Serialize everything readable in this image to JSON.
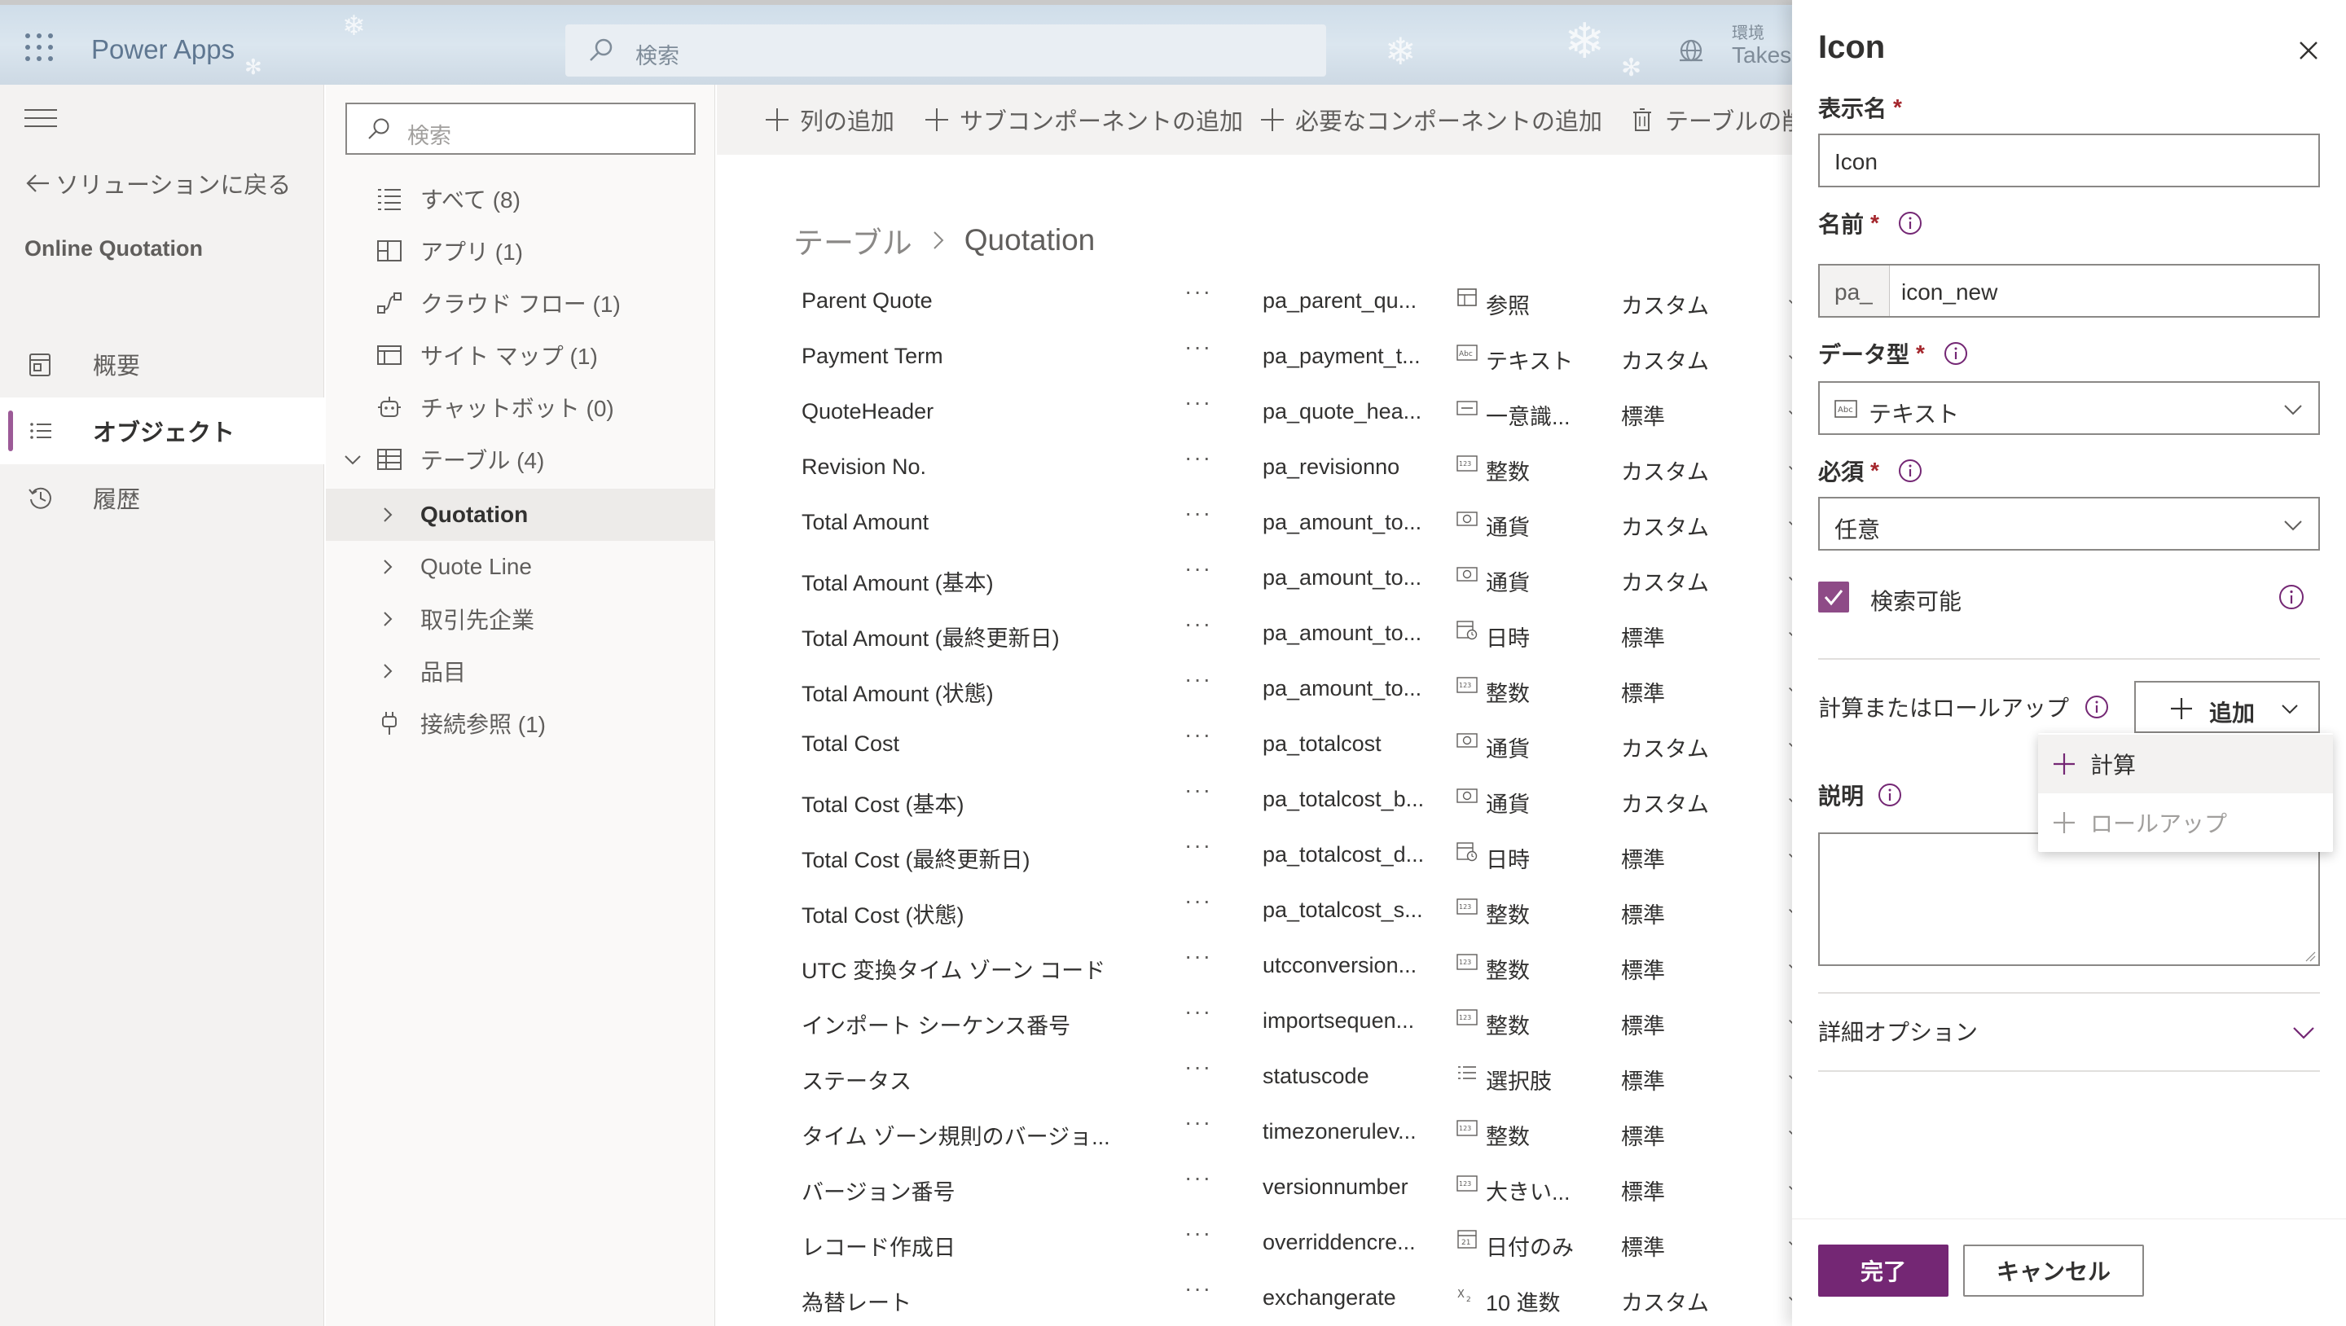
{
  "header": {
    "brand": "Power Apps",
    "search_placeholder": "検索",
    "env_label": "環境",
    "env_user": "Takeshi"
  },
  "leftnav": {
    "back_label": "ソリューションに戻る",
    "solution_name": "Online Quotation",
    "items": [
      {
        "label": "概要",
        "icon": "overview-icon"
      },
      {
        "label": "オブジェクト",
        "icon": "objects-icon",
        "active": true
      },
      {
        "label": "履歴",
        "icon": "history-icon"
      }
    ]
  },
  "tree": {
    "search_placeholder": "検索",
    "items": [
      {
        "label": "すべて (8)",
        "icon": "list-icon"
      },
      {
        "label": "アプリ (1)",
        "icon": "apps-icon"
      },
      {
        "label": "クラウド フロー (1)",
        "icon": "flow-icon"
      },
      {
        "label": "サイト マップ (1)",
        "icon": "sitemap-icon"
      },
      {
        "label": "チャットボット (0)",
        "icon": "bot-icon"
      },
      {
        "label": "テーブル (4)",
        "icon": "table-icon"
      }
    ],
    "tables": [
      "Quotation",
      "Quote Line",
      "取引先企業",
      "品目"
    ],
    "selected_table": "Quotation",
    "connection_refs": "接続参照 (1)"
  },
  "commands": {
    "add_column": "列の追加",
    "add_subcomponent": "サブコンポーネントの追加",
    "add_required": "必要なコンポーネントの追加",
    "delete_table": "テーブルの削除"
  },
  "breadcrumb": {
    "root": "テーブル",
    "current": "Quotation"
  },
  "columns": [
    {
      "display": "Parent Quote",
      "more": "···",
      "name": "pa_parent_qu...",
      "type": "参照",
      "type_icon": "lookup",
      "kind": "カスタム"
    },
    {
      "display": "Payment Term",
      "more": "···",
      "name": "pa_payment_t...",
      "type": "テキスト",
      "type_icon": "text",
      "kind": "カスタム"
    },
    {
      "display": "QuoteHeader",
      "more": "···",
      "name": "pa_quote_hea...",
      "type": "一意識...",
      "type_icon": "unique",
      "kind": "標準"
    },
    {
      "display": "Revision No.",
      "more": "···",
      "name": "pa_revisionno",
      "type": "整数",
      "type_icon": "number",
      "kind": "カスタム"
    },
    {
      "display": "Total Amount",
      "more": "···",
      "name": "pa_amount_to...",
      "type": "通貨",
      "type_icon": "currency",
      "kind": "カスタム"
    },
    {
      "display": "Total Amount (基本)",
      "more": "···",
      "name": "pa_amount_to...",
      "type": "通貨",
      "type_icon": "currency",
      "kind": "カスタム"
    },
    {
      "display": "Total Amount (最終更新日)",
      "more": "···",
      "name": "pa_amount_to...",
      "type": "日時",
      "type_icon": "datetime",
      "kind": "標準"
    },
    {
      "display": "Total Amount (状態)",
      "more": "···",
      "name": "pa_amount_to...",
      "type": "整数",
      "type_icon": "number",
      "kind": "標準"
    },
    {
      "display": "Total Cost",
      "more": "···",
      "name": "pa_totalcost",
      "type": "通貨",
      "type_icon": "currency",
      "kind": "カスタム"
    },
    {
      "display": "Total Cost (基本)",
      "more": "···",
      "name": "pa_totalcost_b...",
      "type": "通貨",
      "type_icon": "currency",
      "kind": "カスタム"
    },
    {
      "display": "Total Cost (最終更新日)",
      "more": "···",
      "name": "pa_totalcost_d...",
      "type": "日時",
      "type_icon": "datetime",
      "kind": "標準"
    },
    {
      "display": "Total Cost (状態)",
      "more": "···",
      "name": "pa_totalcost_s...",
      "type": "整数",
      "type_icon": "number",
      "kind": "標準"
    },
    {
      "display": "UTC 変換タイム ゾーン コード",
      "more": "···",
      "name": "utcconversion...",
      "type": "整数",
      "type_icon": "number",
      "kind": "標準"
    },
    {
      "display": "インポート シーケンス番号",
      "more": "···",
      "name": "importsequen...",
      "type": "整数",
      "type_icon": "number",
      "kind": "標準"
    },
    {
      "display": "ステータス",
      "more": "···",
      "name": "statuscode",
      "type": "選択肢",
      "type_icon": "choice",
      "kind": "標準"
    },
    {
      "display": "タイム ゾーン規則のバージョ...",
      "more": "···",
      "name": "timezonerulev...",
      "type": "整数",
      "type_icon": "number",
      "kind": "標準"
    },
    {
      "display": "バージョン番号",
      "more": "···",
      "name": "versionnumber",
      "type": "大きい...",
      "type_icon": "number",
      "kind": "標準"
    },
    {
      "display": "レコード作成日",
      "more": "···",
      "name": "overriddencre...",
      "type": "日付のみ",
      "type_icon": "date",
      "kind": "標準"
    },
    {
      "display": "為替レート",
      "more": "···",
      "name": "exchangerate",
      "type": "10 進数",
      "type_icon": "decimal",
      "kind": "カスタム"
    }
  ],
  "panel": {
    "title": "Icon",
    "display_name_label": "表示名",
    "display_name_value": "Icon",
    "name_label": "名前",
    "name_prefix": "pa_",
    "name_value": "icon_new",
    "data_type_label": "データ型",
    "data_type_value": "テキスト",
    "required_label": "必須",
    "required_value": "任意",
    "searchable_label": "検索可能",
    "searchable_checked": true,
    "calc_label": "計算またはロールアップ",
    "add_label": "追加",
    "description_label": "説明",
    "advanced_label": "詳細オプション",
    "done_label": "完了",
    "cancel_label": "キャンセル",
    "required_mark": "*"
  },
  "add_menu": {
    "items": [
      {
        "label": "計算",
        "state": "hover"
      },
      {
        "label": "ロールアップ",
        "state": "disabled"
      }
    ]
  },
  "colors": {
    "accent": "#742774",
    "checkbox": "#8e4b87",
    "nav_active_bar": "#9c5a97"
  }
}
